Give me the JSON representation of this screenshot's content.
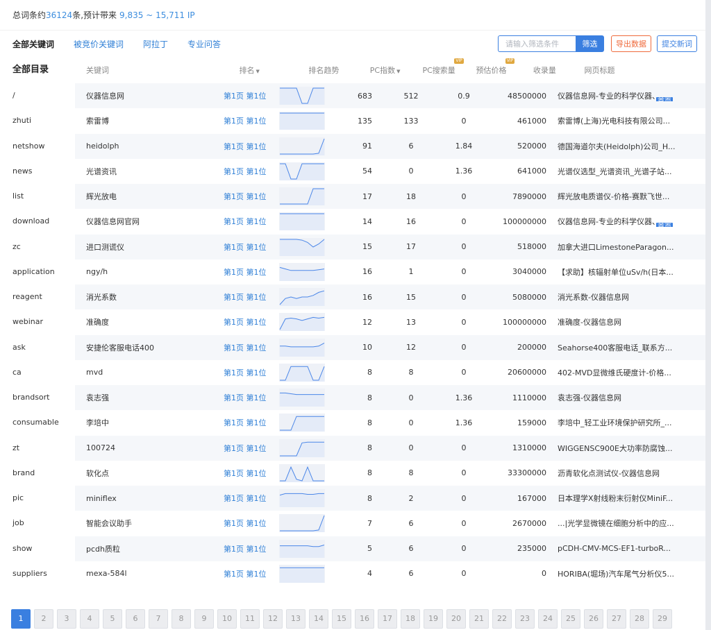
{
  "summary": {
    "prefix": "总词条约",
    "count": "36124",
    "middle": "条,预计带来",
    "traffic": "9,835 ~ 15,711 IP"
  },
  "tabs": [
    "全部关键词",
    "被竞价关键词",
    "阿拉丁",
    "专业问答"
  ],
  "toolbar": {
    "filter_placeholder": "请输入筛选条件",
    "filter_button": "筛选",
    "export_button": "导出数据",
    "submit_button": "提交新词"
  },
  "sidebar": {
    "title": "全部目录",
    "items": [
      "/",
      "zhuti",
      "netshow",
      "news",
      "list",
      "download",
      "zc",
      "application",
      "reagent",
      "webinar",
      "ask",
      "ca",
      "brandsort",
      "consumable",
      "zt",
      "brand",
      "pic",
      "job",
      "show",
      "suppliers"
    ]
  },
  "columns": {
    "keyword": "关键词",
    "rank": "排名",
    "trend": "排名趋势",
    "pc_index": "PC指数",
    "pc_search": "PC搜索量",
    "price": "预估价格",
    "indexed": "收录量",
    "title": "网页标题",
    "vip": "VIP"
  },
  "home_tag": "首页",
  "rows": [
    {
      "keyword": "仪器信息网",
      "rank": "第1页 第1位",
      "trend": [
        0,
        0,
        0,
        0,
        1,
        1,
        0,
        0,
        0
      ],
      "pc_index": "683",
      "pc_search": "512",
      "price": "0.9",
      "indexed": "48500000",
      "title": "仪器信息网-专业的科学仪器、",
      "home": true
    },
    {
      "keyword": "索雷博",
      "rank": "第1页 第1位",
      "trend": [
        0,
        0,
        0,
        0,
        0,
        0,
        0,
        0,
        0
      ],
      "pc_index": "135",
      "pc_search": "133",
      "price": "0",
      "indexed": "461000",
      "title": "索雷博(上海)光电科技有限公司...",
      "home": false
    },
    {
      "keyword": "heidolph",
      "rank": "第1页 第1位",
      "trend": [
        1,
        1,
        1,
        1,
        1,
        1,
        1,
        0.95,
        0
      ],
      "pc_index": "91",
      "pc_search": "6",
      "price": "1.84",
      "indexed": "520000",
      "title": "德国海道尔夫(Heidolph)公司_H...",
      "home": false
    },
    {
      "keyword": "光谱资讯",
      "rank": "第1页 第1位",
      "trend": [
        0,
        0,
        1,
        1,
        0,
        0,
        0,
        0,
        0
      ],
      "pc_index": "54",
      "pc_search": "0",
      "price": "1.36",
      "indexed": "641000",
      "title": "光谱仪选型_光谱资讯_光谱子站...",
      "home": false
    },
    {
      "keyword": "辉光放电",
      "rank": "第1页 第1位",
      "trend": [
        1,
        1,
        1,
        1,
        1,
        1,
        0,
        0,
        0
      ],
      "pc_index": "17",
      "pc_search": "18",
      "price": "0",
      "indexed": "7890000",
      "title": "辉光放电质谱仪-价格-赛默飞世...",
      "home": false
    },
    {
      "keyword": "仪器信息网官网",
      "rank": "第1页 第1位",
      "trend": [
        0,
        0,
        0,
        0,
        0,
        0,
        0,
        0,
        0
      ],
      "pc_index": "14",
      "pc_search": "16",
      "price": "0",
      "indexed": "100000000",
      "title": "仪器信息网-专业的科学仪器、",
      "home": true
    },
    {
      "keyword": "进口测谎仪",
      "rank": "第1页 第1位",
      "trend": [
        0,
        0,
        0,
        0,
        0.05,
        0.2,
        0.5,
        0.3,
        0
      ],
      "pc_index": "15",
      "pc_search": "17",
      "price": "0",
      "indexed": "518000",
      "title": "加拿大进口LimestoneParagon...",
      "home": false
    },
    {
      "keyword": "ngy/h",
      "rank": "第1页 第1位",
      "trend": [
        0.2,
        0.3,
        0.4,
        0.4,
        0.4,
        0.4,
        0.4,
        0.35,
        0.3
      ],
      "pc_index": "16",
      "pc_search": "1",
      "price": "0",
      "indexed": "3040000",
      "title": "【求助】核辐射单位uSv/h(日本...",
      "home": false
    },
    {
      "keyword": "消光系数",
      "rank": "第1页 第1位",
      "trend": [
        1,
        0.6,
        0.5,
        0.6,
        0.5,
        0.5,
        0.4,
        0.2,
        0.1
      ],
      "pc_index": "16",
      "pc_search": "15",
      "price": "0",
      "indexed": "5080000",
      "title": "消光系数-仪器信息网",
      "home": false
    },
    {
      "keyword": "准确度",
      "rank": "第1页 第1位",
      "trend": [
        1,
        0.3,
        0.25,
        0.3,
        0.4,
        0.3,
        0.2,
        0.25,
        0.2
      ],
      "pc_index": "12",
      "pc_search": "13",
      "price": "0",
      "indexed": "100000000",
      "title": "准确度-仪器信息网",
      "home": false
    },
    {
      "keyword": "安捷伦客服电话400",
      "rank": "第1页 第1位",
      "trend": [
        0.4,
        0.4,
        0.45,
        0.45,
        0.45,
        0.45,
        0.45,
        0.4,
        0.2
      ],
      "pc_index": "10",
      "pc_search": "12",
      "price": "0",
      "indexed": "200000",
      "title": "Seahorse400客服电话_联系方...",
      "home": false
    },
    {
      "keyword": "mvd",
      "rank": "第1页 第1位",
      "trend": [
        1,
        1,
        0.1,
        0.1,
        0.1,
        0.1,
        1,
        1,
        0.1
      ],
      "pc_index": "8",
      "pc_search": "8",
      "price": "0",
      "indexed": "20600000",
      "title": "402-MVD显微维氏硬度计-价格...",
      "home": false
    },
    {
      "keyword": "袁志强",
      "rank": "第1页 第1位",
      "trend": [
        0.2,
        0.2,
        0.25,
        0.3,
        0.3,
        0.3,
        0.3,
        0.3,
        0.3
      ],
      "pc_index": "8",
      "pc_search": "0",
      "price": "1.36",
      "indexed": "1110000",
      "title": "袁志强-仪器信息网",
      "home": false
    },
    {
      "keyword": "李培中",
      "rank": "第1页 第1位",
      "trend": [
        1,
        1,
        1,
        0.1,
        0.1,
        0.1,
        0.1,
        0.1,
        0.1
      ],
      "pc_index": "8",
      "pc_search": "0",
      "price": "1.36",
      "indexed": "159000",
      "title": "李培中_轻工业环境保护研究所_...",
      "home": false
    },
    {
      "keyword": "100724",
      "rank": "第1页 第1位",
      "trend": [
        1,
        1,
        1,
        1,
        0.15,
        0.1,
        0.1,
        0.1,
        0.1
      ],
      "pc_index": "8",
      "pc_search": "0",
      "price": "0",
      "indexed": "1310000",
      "title": "WIGGENSC900E大功率防腐蚀...",
      "home": false
    },
    {
      "keyword": "软化点",
      "rank": "第1页 第1位",
      "trend": [
        1,
        1,
        0.1,
        0.9,
        1,
        0.1,
        1,
        1,
        1
      ],
      "pc_index": "8",
      "pc_search": "8",
      "price": "0",
      "indexed": "33300000",
      "title": "沥青软化点测试仪-仪器信息网",
      "home": false
    },
    {
      "keyword": "miniflex",
      "rank": "第1页 第1位",
      "trend": [
        0.3,
        0.2,
        0.2,
        0.2,
        0.2,
        0.25,
        0.25,
        0.2,
        0.2
      ],
      "pc_index": "8",
      "pc_search": "2",
      "price": "0",
      "indexed": "167000",
      "title": "日本理学X射线粉末衍射仪MiniF...",
      "home": false
    },
    {
      "keyword": "智能会议助手",
      "rank": "第1页 第1位",
      "trend": [
        1,
        1,
        1,
        1,
        1,
        1,
        1,
        0.95,
        0
      ],
      "pc_index": "7",
      "pc_search": "6",
      "price": "0",
      "indexed": "2670000",
      "title": "...|光学显微镜在细胞分析中的应...",
      "home": false
    },
    {
      "keyword": "pcdh质粒",
      "rank": "第1页 第1位",
      "trend": [
        0.3,
        0.3,
        0.3,
        0.3,
        0.3,
        0.3,
        0.35,
        0.35,
        0.25
      ],
      "pc_index": "5",
      "pc_search": "6",
      "price": "0",
      "indexed": "235000",
      "title": "pCDH-CMV-MCS-EF1-turboR...",
      "home": false
    },
    {
      "keyword": "mexa-584l",
      "rank": "第1页 第1位",
      "trend": [
        0.1,
        0.1,
        0.1,
        0.1,
        0.1,
        0.1,
        0.1,
        0.1,
        0.1
      ],
      "pc_index": "4",
      "pc_search": "6",
      "price": "0",
      "indexed": "0",
      "title": "HORIBA(堀场)汽车尾气分析仪5...",
      "home": false
    }
  ],
  "pagination": {
    "current": "1",
    "pages": [
      "1",
      "2",
      "3",
      "4",
      "5",
      "6",
      "7",
      "8",
      "9",
      "10",
      "11",
      "12",
      "13",
      "14",
      "15",
      "16",
      "17",
      "18",
      "19",
      "20",
      "21",
      "22",
      "23",
      "24",
      "25",
      "26",
      "27",
      "28",
      "29"
    ]
  },
  "colors": {
    "accent": "#3a7fe0",
    "link": "#2f7fd6",
    "export": "#ef6a3b",
    "row_stripe": "#f5f7fa",
    "trend_line": "#4a86e8",
    "vip": "#e0a840"
  }
}
